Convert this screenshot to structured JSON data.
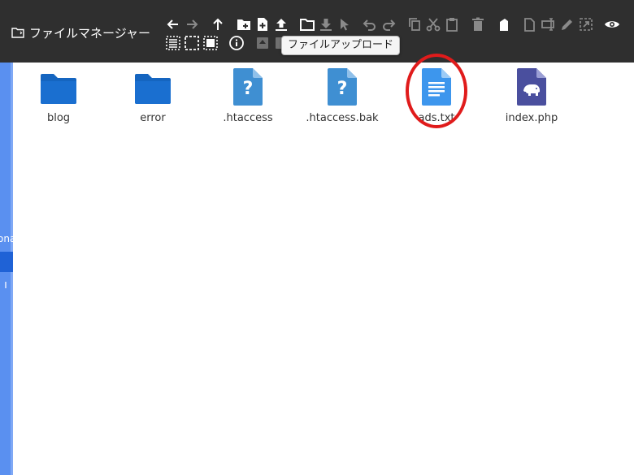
{
  "header": {
    "title": "ファイルマネージャー",
    "title_icon": "folder-outline-icon"
  },
  "toolbar": {
    "buttons": [
      {
        "name": "back",
        "icon": "arrow-left-icon",
        "enabled": true
      },
      {
        "name": "forward",
        "icon": "arrow-right-icon",
        "enabled": false
      },
      {
        "name": "up",
        "icon": "arrow-up-icon",
        "enabled": true
      },
      {
        "name": "new-folder",
        "icon": "folder-plus-icon",
        "enabled": true
      },
      {
        "name": "new-file",
        "icon": "file-plus-icon",
        "enabled": true
      },
      {
        "name": "upload",
        "icon": "upload-icon",
        "enabled": true
      },
      {
        "name": "open",
        "icon": "folder-open-icon",
        "enabled": true
      },
      {
        "name": "download",
        "icon": "download-icon",
        "enabled": false
      },
      {
        "name": "select",
        "icon": "cursor-icon",
        "enabled": false
      },
      {
        "name": "undo",
        "icon": "undo-icon",
        "enabled": false
      },
      {
        "name": "redo",
        "icon": "redo-icon",
        "enabled": false
      },
      {
        "name": "copy",
        "icon": "copy-icon",
        "enabled": false
      },
      {
        "name": "cut",
        "icon": "scissors-icon",
        "enabled": false
      },
      {
        "name": "paste",
        "icon": "clipboard-icon",
        "enabled": false
      },
      {
        "name": "delete",
        "icon": "trash-icon",
        "enabled": false
      },
      {
        "name": "empty",
        "icon": "eraser-icon",
        "enabled": true
      },
      {
        "name": "duplicate",
        "icon": "duplicate-icon",
        "enabled": false
      },
      {
        "name": "rename",
        "icon": "rename-icon",
        "enabled": false
      },
      {
        "name": "edit",
        "icon": "pencil-icon",
        "enabled": false
      },
      {
        "name": "resize",
        "icon": "resize-icon",
        "enabled": false
      },
      {
        "name": "preview",
        "icon": "eye-icon",
        "enabled": true
      },
      {
        "name": "select-all",
        "icon": "select-all-icon",
        "enabled": true
      },
      {
        "name": "select-none",
        "icon": "select-none-icon",
        "enabled": true
      },
      {
        "name": "invert-selection",
        "icon": "invert-selection-icon",
        "enabled": true
      },
      {
        "name": "info",
        "icon": "info-icon",
        "enabled": true
      },
      {
        "name": "extract",
        "icon": "archive-icon",
        "enabled": false
      }
    ],
    "tooltip": "ファイルアップロード"
  },
  "sidebar": {
    "partial_label": "ona"
  },
  "files": [
    {
      "name": "blog",
      "icon": "folder-icon",
      "selected": false
    },
    {
      "name": "error",
      "icon": "folder-icon",
      "selected": false
    },
    {
      "name": ".htaccess",
      "icon": "unknown-file-icon",
      "selected": false
    },
    {
      "name": ".htaccess.bak",
      "icon": "unknown-file-icon",
      "selected": false
    },
    {
      "name": "ads.txt",
      "icon": "text-file-icon",
      "selected": false,
      "highlighted": true
    },
    {
      "name": "index.php",
      "icon": "php-file-icon",
      "selected": false
    }
  ],
  "colors": {
    "toolbar_bg": "#2f2f2f",
    "folder": "#1565c0",
    "unknown_file": "#3f8fd2",
    "text_file": "#3d96ed",
    "php_file": "#4a4f9e",
    "highlight": "#e01b1b",
    "sidebar": "#5a90f0"
  }
}
